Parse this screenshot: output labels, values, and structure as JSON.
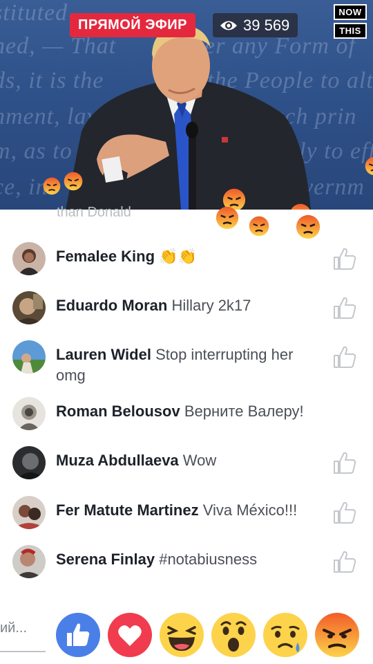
{
  "live": {
    "badge": "ПРЯМОЙ ЭФИР",
    "viewer_count": "39 569",
    "channel_logo": [
      "NOW",
      "THIS"
    ]
  },
  "background_text": [
    "stituted",
    "ned, — That",
    "ds, it is the",
    "nment, lay",
    "m, as to",
    "ce, in",
    "er any Form of",
    "the People to alter",
    "such prin",
    "likely to eff",
    "overnm"
  ],
  "previous_comment_tail": "than Donald",
  "comments": [
    {
      "name": "Femalee King",
      "text": "",
      "emoji": "👏👏",
      "has_like": true
    },
    {
      "name": "Eduardo Moran",
      "text": "Hillary 2k17",
      "emoji": "",
      "has_like": true
    },
    {
      "name": "Lauren Widel",
      "text": "Stop interrupting her omg",
      "emoji": "",
      "has_like": true
    },
    {
      "name": "Roman Belousov",
      "text": "Верните Валеру!",
      "emoji": "",
      "has_like": false
    },
    {
      "name": "Muza Abdullaeva",
      "text": "Wow",
      "emoji": "",
      "has_like": true
    },
    {
      "name": "Fer Matute Martinez",
      "text": "Viva México!!!",
      "emoji": "",
      "has_like": true
    },
    {
      "name": "Serena Finlay",
      "text": "#notabiusness",
      "emoji": "",
      "has_like": true
    }
  ],
  "composer": {
    "placeholder_tail": "ий..."
  },
  "reactions": [
    "like-icon",
    "love-icon",
    "haha-icon",
    "wow-icon",
    "sad-icon",
    "angry-icon"
  ],
  "colors": {
    "live_red": "#e4293f",
    "like_blue": "#4a7fe8",
    "love_red": "#f03c4e",
    "emoji_yellow": "#fcd34a",
    "angry_orange": "#f25c28"
  }
}
